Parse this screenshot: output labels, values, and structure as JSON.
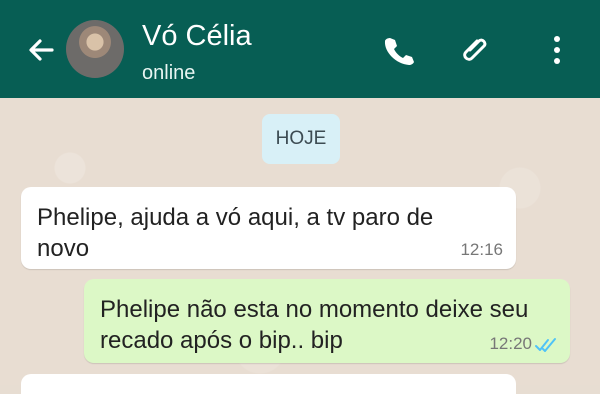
{
  "header": {
    "contact_name": "Vó Célia",
    "status": "online"
  },
  "chat": {
    "date_label": "HOJE",
    "messages": [
      {
        "text": "Phelipe, ajuda a vó aqui, a tv paro de novo",
        "time": "12:16"
      },
      {
        "text": "Phelipe não esta no momento deixe seu recado após o bip.. bip",
        "time": "12:20"
      }
    ]
  },
  "colors": {
    "header": "#075e54",
    "outgoing": "#dcf8c6",
    "incoming": "#ffffff",
    "date_pill": "#d8f0f7",
    "read_ticks": "#4fc3f7"
  },
  "icons": [
    "back-arrow-icon",
    "avatar",
    "phone-icon",
    "paperclip-icon",
    "more-vertical-icon",
    "double-check-icon"
  ]
}
